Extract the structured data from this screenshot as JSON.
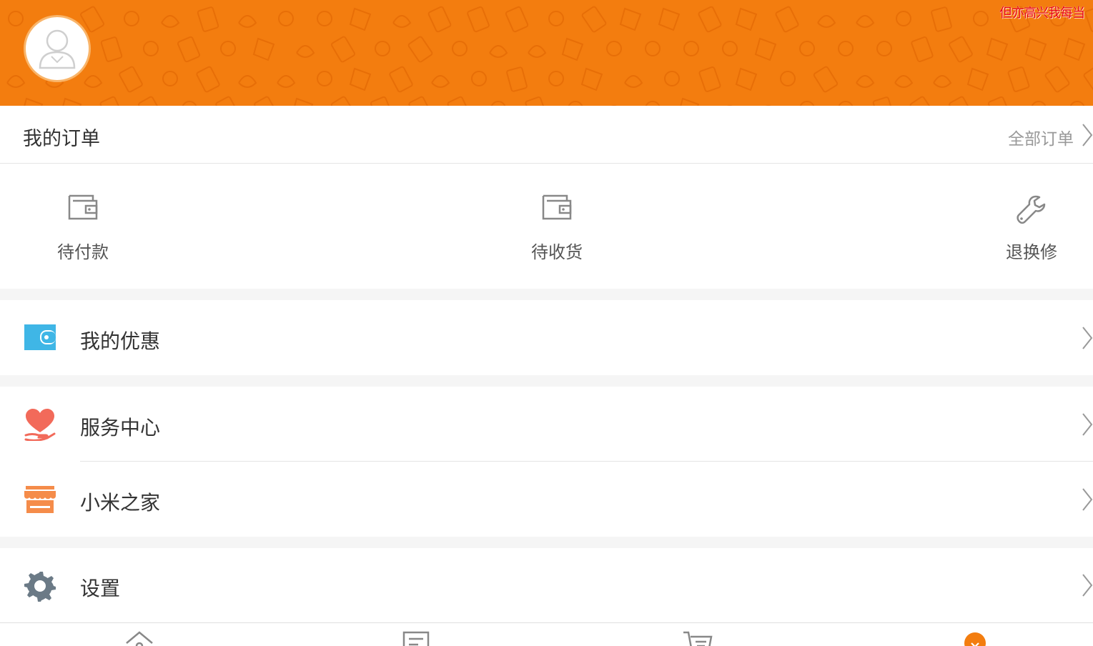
{
  "header": {
    "brand_color": "#f37d0f",
    "marquee_text": "但亦高兴我每当",
    "avatar_icon": "user-avatar-icon"
  },
  "orders": {
    "title": "我的订单",
    "all_orders_label": "全部订单",
    "items": [
      {
        "label": "待付款",
        "icon": "wallet-icon"
      },
      {
        "label": "待收货",
        "icon": "wallet-icon"
      },
      {
        "label": "退换修",
        "icon": "wrench-icon"
      }
    ]
  },
  "menu": {
    "coupons": {
      "label": "我的优惠",
      "icon": "wallet-icon",
      "color": "#3fb6e6"
    },
    "service": {
      "label": "服务中心",
      "icon": "heart-hand-icon",
      "color": "#f26a5a"
    },
    "mi_home": {
      "label": "小米之家",
      "icon": "store-icon",
      "color": "#f58c4a"
    },
    "settings": {
      "label": "设置",
      "icon": "gear-icon",
      "color": "#6b7a86"
    }
  },
  "tabbar": {
    "tabs": [
      {
        "icon": "home-icon"
      },
      {
        "icon": "category-icon"
      },
      {
        "icon": "cart-icon"
      },
      {
        "icon": "profile-icon",
        "active": true
      }
    ],
    "active_color": "#f37d0f"
  }
}
